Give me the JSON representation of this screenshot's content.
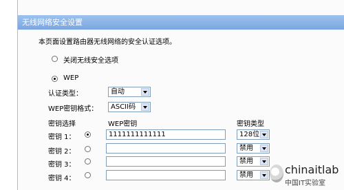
{
  "window": {
    "title": "无线网络安全设置"
  },
  "description": "本页面设置路由器无线网络的安全认证选项。",
  "options": {
    "disable_label": "关闭无线安全选项",
    "wep_label": "WEP"
  },
  "auth_type": {
    "label": "认证类型：",
    "value": "自动"
  },
  "wep_format": {
    "label": "WEP密钥格式：",
    "value": "ASCII码"
  },
  "table": {
    "headers": {
      "select": "密钥选择",
      "key": "WEP密钥",
      "type": "密钥类型"
    },
    "rows": [
      {
        "label": "密钥 1：",
        "value": "1111111111111",
        "type": "128位",
        "selected": true
      },
      {
        "label": "密钥 2：",
        "value": "",
        "type": "禁用",
        "selected": false
      },
      {
        "label": "密钥 3：",
        "value": "",
        "type": "禁用",
        "selected": false
      },
      {
        "label": "密钥 4：",
        "value": "",
        "type": "禁用",
        "selected": false
      }
    ]
  },
  "watermark": {
    "brand": "chinaitlab",
    "subtitle": "中国IT实验室"
  }
}
